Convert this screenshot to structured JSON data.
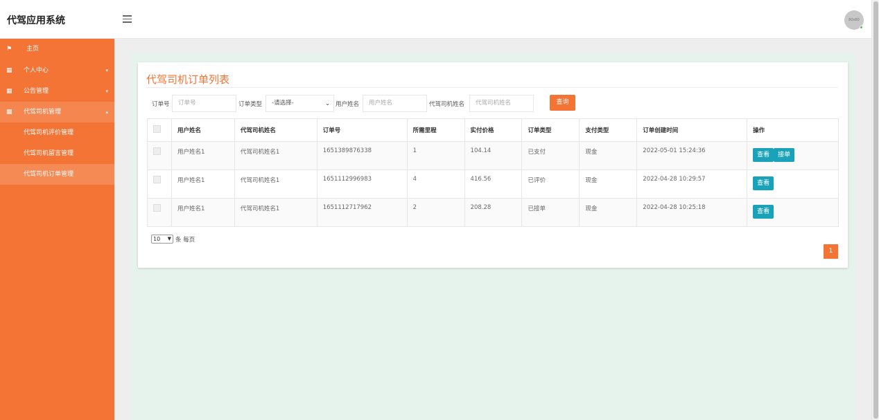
{
  "app": {
    "title": "代驾应用系统",
    "avatar_text": "80x80"
  },
  "sidebar": {
    "items": [
      {
        "label": "主页",
        "icon": "flag-icon"
      },
      {
        "label": "个人中心",
        "icon": "grid-icon",
        "arrow": "▾"
      },
      {
        "label": "公告管理",
        "icon": "grid-icon",
        "arrow": "▾"
      },
      {
        "label": "代驾司机管理",
        "icon": "grid-icon",
        "arrow": "▴"
      }
    ],
    "sub_items": [
      "代驾司机评价管理",
      "代驾司机留言管理",
      "代驾司机订单管理"
    ]
  },
  "page": {
    "title": "代驾司机订单列表"
  },
  "search": {
    "order_no_label": "订单号",
    "order_no_placeholder": "订单号",
    "order_type_label": "订单类型",
    "order_type_value": "-请选择-",
    "user_name_label": "用户姓名",
    "user_name_placeholder": "用户姓名",
    "driver_name_label": "代驾司机姓名",
    "driver_name_placeholder": "代驾司机姓名",
    "query_label": "查询"
  },
  "table": {
    "headers": [
      "用户姓名",
      "代驾司机姓名",
      "订单号",
      "所需里程",
      "实付价格",
      "订单类型",
      "支付类型",
      "订单创建时间",
      "操作"
    ],
    "rows": [
      {
        "user": "用户姓名1",
        "driver": "代驾司机姓名1",
        "order_no": "1651389876338",
        "mileage": "1",
        "price": "104.14",
        "order_type": "已支付",
        "pay_type": "现金",
        "created": "2022-05-01 15:24:36",
        "actions": [
          "查看",
          "接单"
        ]
      },
      {
        "user": "用户姓名1",
        "driver": "代驾司机姓名1",
        "order_no": "1651112996983",
        "mileage": "4",
        "price": "416.56",
        "order_type": "已评价",
        "pay_type": "现金",
        "created": "2022-04-28 10:29:57",
        "actions": [
          "查看"
        ]
      },
      {
        "user": "用户姓名1",
        "driver": "代驾司机姓名1",
        "order_no": "1651112717962",
        "mileage": "2",
        "price": "208.28",
        "order_type": "已接单",
        "pay_type": "现金",
        "created": "2022-04-28 10:25:18",
        "actions": [
          "查看"
        ]
      }
    ]
  },
  "pager": {
    "page_size": "10",
    "page_size_text": "条 每页",
    "current_page": "1"
  },
  "colors": {
    "accent": "#f37435",
    "action_button": "#1aa3b8",
    "content_bg": "#e6f2ec"
  }
}
